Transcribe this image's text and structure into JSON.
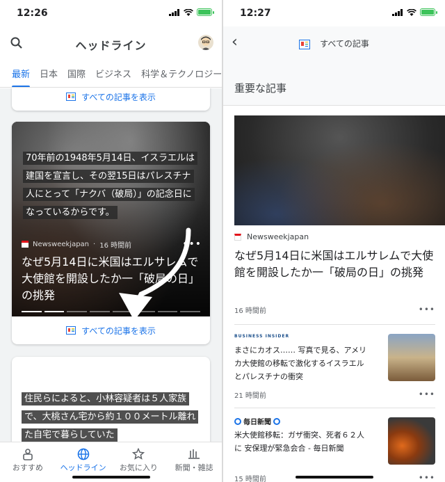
{
  "left": {
    "status": {
      "time": "12:26"
    },
    "header": {
      "title": "ヘッドライン"
    },
    "tabs": [
      "最新",
      "日本",
      "国際",
      "ビジネス",
      "科学＆テクノロジー"
    ],
    "see_all": "すべての記事を表示",
    "card": {
      "quote": "70年前の1948年5月14日、イスラエルは建国を宣言し、その翌15日はパレスチナ人にとって「ナクバ（破局）」の記念日になっているからです。",
      "source": "Newsweekjapan",
      "time": "16 時間前",
      "title": "なぜ5月14日に米国はエルサレムで大使館を開設したか一「破局の日」の挑発"
    },
    "next_quote": "住民らによると、小林容疑者は５人家族で、大桃さん宅から約１００メートル離れた自宅で暮らしていた",
    "bottom_nav": [
      "おすすめ",
      "ヘッドライン",
      "お気に入り",
      "新聞・雑誌"
    ]
  },
  "right": {
    "status": {
      "time": "12:27"
    },
    "header": {
      "title": "すべての記事"
    },
    "section_title": "重要な記事",
    "main": {
      "source": "Newsweekjapan",
      "title": "なぜ5月14日に米国はエルサレムで大使館を開設したか一「破局の日」の挑発",
      "time": "16 時間前"
    },
    "articles": [
      {
        "source": "BUSINESS INSIDER",
        "title": "まさにカオス…… 写真で見る、アメリカ大使館の移転で激化するイスラエルとパレスチナの衝突",
        "time": "21 時間前"
      },
      {
        "source": "毎日新聞",
        "title": "米大使館移転：ガザ衝突、死者６２人に 安保理が緊急会合 - 毎日新聞",
        "time": "15 時間前"
      }
    ]
  },
  "colors": {
    "accent": "#1a73e8",
    "battery": "#3cc35a"
  }
}
